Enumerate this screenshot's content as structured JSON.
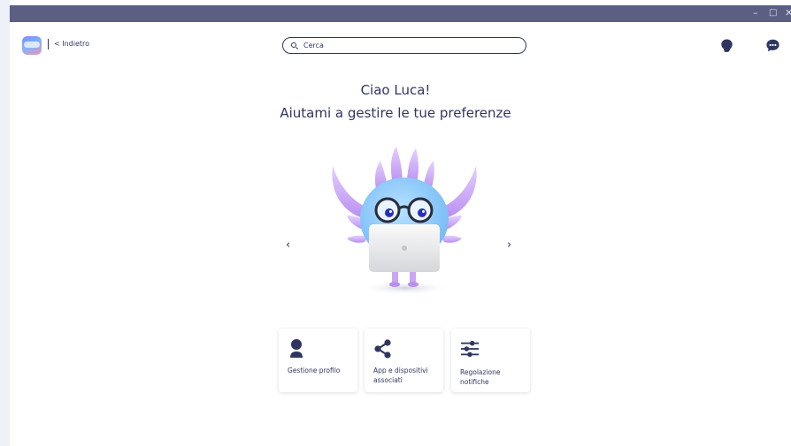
{
  "window": {
    "controls": {
      "minimize": "–",
      "maximize": "□",
      "close": "✕"
    }
  },
  "header": {
    "logo_icon": "app-logo-icon",
    "back_label": "< Indietro",
    "search": {
      "placeholder": "Cerca",
      "value": ""
    },
    "right_icons": [
      "lightbulb-icon",
      "chat-bubble-icon"
    ]
  },
  "main": {
    "greeting_line1": "Ciao Luca!",
    "greeting_line2": "Aiutami a gestire le tue preferenze",
    "carousel": {
      "prev": "‹",
      "next": "›",
      "illustration": "mascot-with-laptop"
    }
  },
  "cards": [
    {
      "icon": "user-icon",
      "label": "Gestione profilo"
    },
    {
      "icon": "share-icon",
      "label": "App e dispositivi associati"
    },
    {
      "icon": "sliders-icon",
      "label": "Regolazione notifiche"
    }
  ],
  "colors": {
    "titlebar": "#5b5f83",
    "text_primary": "#2f3561",
    "mascot_body": "#8fd0ff",
    "mascot_spikes": "#c9a3f5"
  }
}
